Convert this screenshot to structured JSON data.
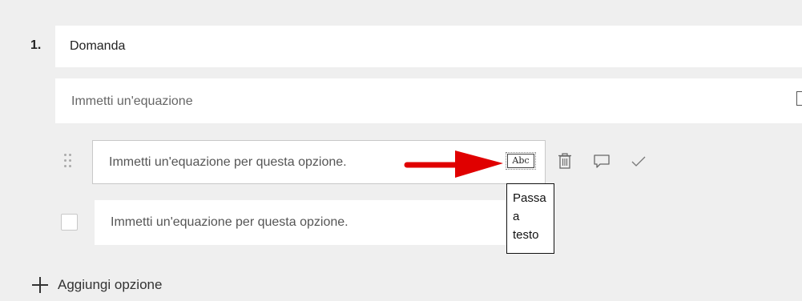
{
  "question": {
    "number": "1.",
    "title": "Domanda",
    "equation_placeholder": "Immetti un'equazione"
  },
  "options": [
    {
      "placeholder": "Immetti un'equazione per questa opzione.",
      "active": true,
      "switch_button_label": "Abc"
    },
    {
      "placeholder": "Immetti un'equazione per questa opzione.",
      "active": false
    }
  ],
  "tooltip": {
    "lines": [
      "Passa",
      "a",
      "testo"
    ]
  },
  "actions": {
    "icons": [
      "trash-icon",
      "comment-icon",
      "check-icon"
    ]
  },
  "add_option_label": "Aggiungi opzione",
  "colors": {
    "background": "#efefef",
    "card": "#ffffff",
    "arrow": "#e00000",
    "border": "#c8c8c8"
  }
}
